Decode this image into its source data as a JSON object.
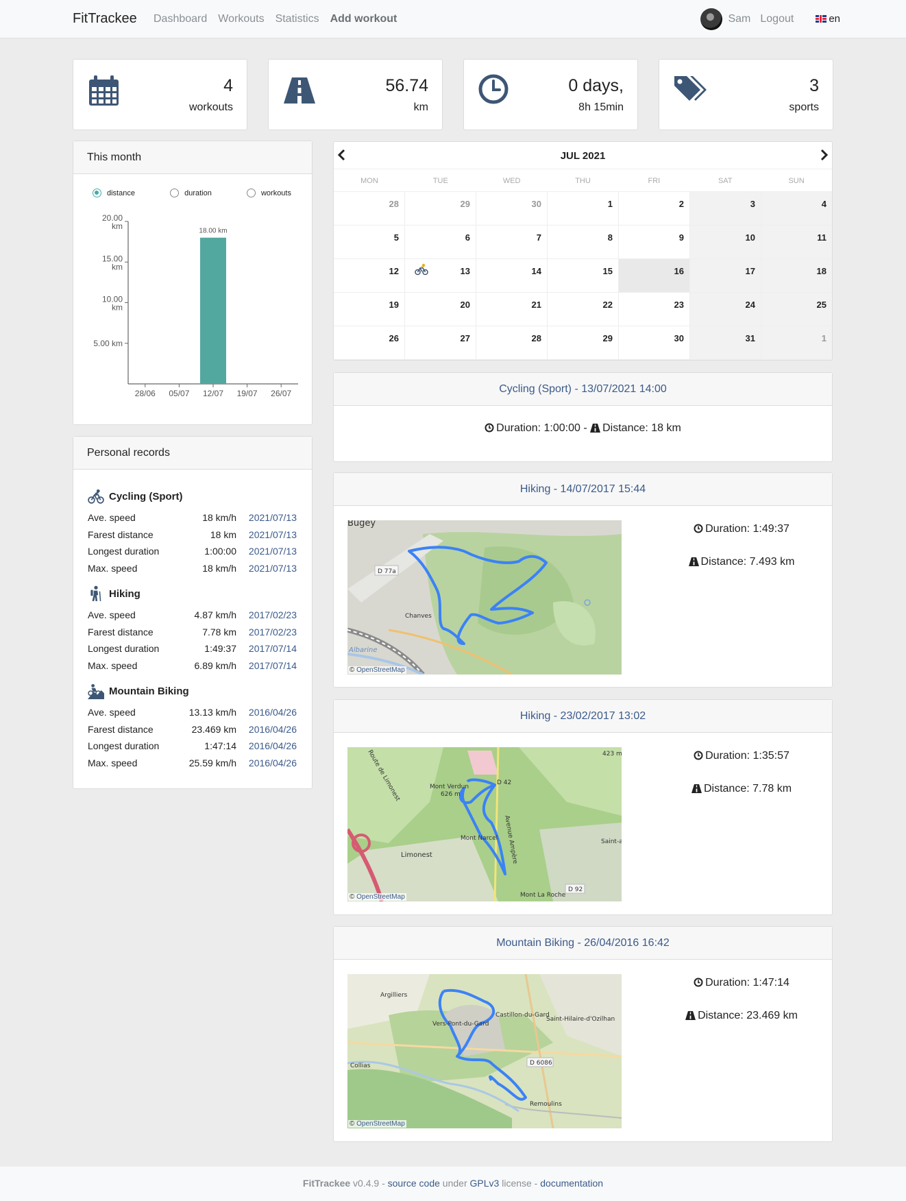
{
  "navbar": {
    "brand": "FitTrackee",
    "links": [
      "Dashboard",
      "Workouts",
      "Statistics",
      "Add workout"
    ],
    "username": "Sam",
    "logout": "Logout",
    "lang": "en"
  },
  "stats": [
    {
      "icon": "calendar-icon",
      "value": "4",
      "label": "workouts"
    },
    {
      "icon": "road-icon",
      "value": "56.74",
      "label": "km"
    },
    {
      "icon": "clock-icon",
      "value": "0 days,",
      "label": "8h 15min"
    },
    {
      "icon": "tags-icon",
      "value": "3",
      "label": "sports"
    }
  ],
  "this_month": {
    "title": "This month",
    "options": [
      "distance",
      "duration",
      "workouts"
    ],
    "selected": "distance"
  },
  "chart_data": {
    "type": "bar",
    "categories": [
      "28/06",
      "05/07",
      "12/07",
      "19/07",
      "26/07"
    ],
    "values": [
      0,
      0,
      18.0,
      0,
      0
    ],
    "data_labels": [
      "",
      "",
      "18.00 km",
      "",
      ""
    ],
    "yticks": [
      "5.00 km",
      "10.00 km",
      "15.00 km",
      "20.00 km"
    ],
    "ytick_values": [
      5,
      10,
      15,
      20
    ],
    "ylim": [
      0,
      20
    ],
    "bar_color": "#52a89f",
    "grid": false,
    "legend": "none"
  },
  "calendar": {
    "title": "JUL 2021",
    "weekdays": [
      "MON",
      "TUE",
      "WED",
      "THU",
      "FRI",
      "SAT",
      "SUN"
    ],
    "weeks": [
      [
        "28",
        "29",
        "30",
        "1",
        "2",
        "3",
        "4"
      ],
      [
        "5",
        "6",
        "7",
        "8",
        "9",
        "10",
        "11"
      ],
      [
        "12",
        "13",
        "14",
        "15",
        "16",
        "17",
        "18"
      ],
      [
        "19",
        "20",
        "21",
        "22",
        "23",
        "24",
        "25"
      ],
      [
        "26",
        "27",
        "28",
        "29",
        "30",
        "31",
        "1"
      ]
    ],
    "today": "16",
    "workout_day": "13"
  },
  "workouts": [
    {
      "title": "Cycling (Sport) - 13/07/2021 14:00",
      "summary_duration": "Duration: 1:00:00",
      "summary_sep": " - ",
      "summary_distance": "Distance: 18 km"
    },
    {
      "title": "Hiking - 14/07/2017 15:44",
      "duration": "Duration: 1:49:37",
      "distance": "Distance: 7.493 km",
      "map_labels": [
        "Bugey",
        "D 77a",
        "Chanves",
        "Albarine"
      ],
      "attribution": "OpenStreetMap"
    },
    {
      "title": "Hiking - 23/02/2017 13:02",
      "duration": "Duration: 1:35:57",
      "distance": "Distance: 7.78 km",
      "map_labels": [
        "Route de Limonest",
        "Mont Verdun",
        "626 m",
        "Limonest",
        "Mont Narcel",
        "Avenue Ampère",
        "Mont La Roche",
        "D 92",
        "Saint-au-M",
        "423 m",
        "D 42"
      ],
      "attribution": "OpenStreetMap"
    },
    {
      "title": "Mountain Biking - 26/04/2016 16:42",
      "duration": "Duration: 1:47:14",
      "distance": "Distance: 23.469 km",
      "map_labels": [
        "Argilliers",
        "Castillon-du-Gard",
        "Saint-Hilaire-d'Ozilhan",
        "Vers-Pont-du-Gard",
        "Collias",
        "D 6086",
        "Remoulins"
      ],
      "attribution": "OpenStreetMap"
    }
  ],
  "records": {
    "title": "Personal records",
    "sports": [
      {
        "name": "Cycling (Sport)",
        "rows": [
          {
            "label": "Ave. speed",
            "value": "18 km/h",
            "date": "2021/07/13"
          },
          {
            "label": "Farest distance",
            "value": "18 km",
            "date": "2021/07/13"
          },
          {
            "label": "Longest duration",
            "value": "1:00:00",
            "date": "2021/07/13"
          },
          {
            "label": "Max. speed",
            "value": "18 km/h",
            "date": "2021/07/13"
          }
        ]
      },
      {
        "name": "Hiking",
        "rows": [
          {
            "label": "Ave. speed",
            "value": "4.87 km/h",
            "date": "2017/02/23"
          },
          {
            "label": "Farest distance",
            "value": "7.78 km",
            "date": "2017/02/23"
          },
          {
            "label": "Longest duration",
            "value": "1:49:37",
            "date": "2017/07/14"
          },
          {
            "label": "Max. speed",
            "value": "6.89 km/h",
            "date": "2017/07/14"
          }
        ]
      },
      {
        "name": "Mountain Biking",
        "rows": [
          {
            "label": "Ave. speed",
            "value": "13.13 km/h",
            "date": "2016/04/26"
          },
          {
            "label": "Farest distance",
            "value": "23.469 km",
            "date": "2016/04/26"
          },
          {
            "label": "Longest duration",
            "value": "1:47:14",
            "date": "2016/04/26"
          },
          {
            "label": "Max. speed",
            "value": "25.59 km/h",
            "date": "2016/04/26"
          }
        ]
      }
    ]
  },
  "footer": {
    "app": "FitTrackee",
    "version": "v0.4.9",
    "sep1": " - ",
    "source": "source code",
    "under": " under ",
    "license": "GPLv3",
    "license_suffix": " license",
    "sep2": " - ",
    "docs": "documentation"
  },
  "colors": {
    "accent": "#3a5a8a",
    "bar": "#52a89f",
    "route": "#3b82f6",
    "icon": "#3e5675"
  }
}
